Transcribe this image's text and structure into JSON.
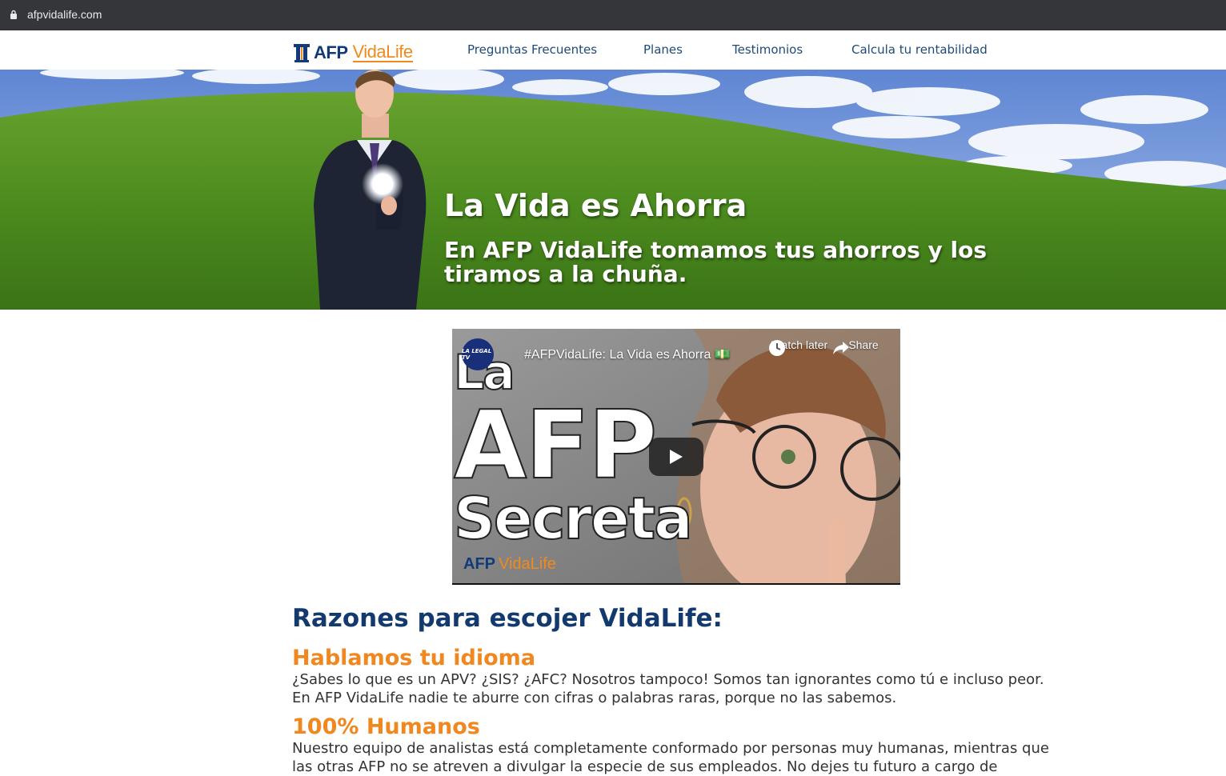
{
  "browser": {
    "url": "afpvidalife.com"
  },
  "navbar": {
    "logo_primary": "AFP",
    "logo_secondary": "VidaLife",
    "links": [
      {
        "label": "Preguntas Frecuentes"
      },
      {
        "label": "Planes"
      },
      {
        "label": "Testimonios"
      },
      {
        "label": "Calcula tu rentabilidad"
      }
    ]
  },
  "hero": {
    "title": "La Vida es Ahorra",
    "subtitle": "En AFP VidaLife tomamos tus ahorros y los tiramos a la chuña."
  },
  "video": {
    "channel": "LA LEGAL TV",
    "title": "#AFPVidaLife: La Vida es Ahorra 💵",
    "watch_later": "Watch later",
    "share": "Share",
    "thumb_line1": "La",
    "thumb_line2": "AFP",
    "thumb_line3": "Secreta",
    "watermark_primary": "AFP",
    "watermark_secondary": "VidaLife"
  },
  "reasons": {
    "heading": "Razones para escojer VidaLife:",
    "items": [
      {
        "title": "Hablamos tu idioma",
        "text": "¿Sabes lo que es un APV? ¿SIS? ¿AFC? Nosotros tampoco! Somos tan ignorantes como tú e incluso peor. En AFP VidaLife nadie te aburre con cifras o palabras raras, porque no las sabemos."
      },
      {
        "title": "100% Humanos",
        "text": "Nuestro equipo de analistas está completamente conformado por personas muy humanas, mientras que las otras AFP no se atreven a divulgar la especie de sus empleados. No dejes tu futuro a cargo de"
      }
    ]
  },
  "colors": {
    "nav_link": "#1d4a7a",
    "heading_blue": "#123a6e",
    "accent_orange": "#f0871f",
    "body_text": "#333333"
  }
}
